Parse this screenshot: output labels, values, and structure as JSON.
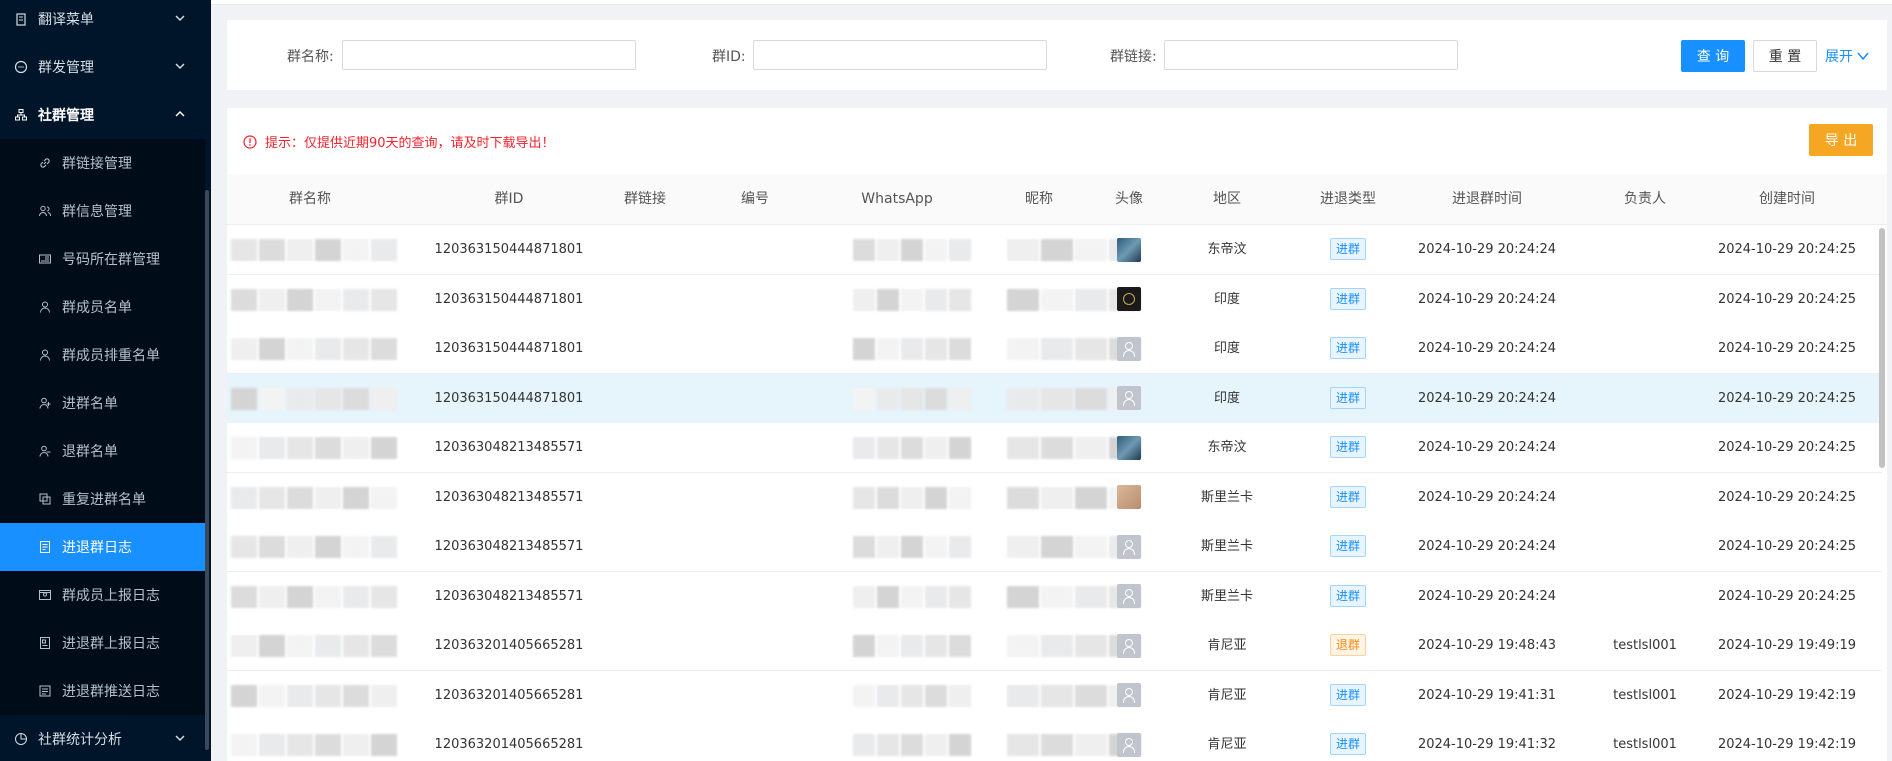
{
  "sidebar": {
    "items": [
      {
        "label": "翻译菜单",
        "icon": "clipboard-icon",
        "level": "top",
        "expanded": false
      },
      {
        "label": "群发管理",
        "icon": "chat-icon",
        "level": "top",
        "expanded": false
      },
      {
        "label": "社群管理",
        "icon": "org-icon",
        "level": "top",
        "expanded": true
      },
      {
        "label": "群链接管理",
        "icon": "link-icon",
        "level": "sub"
      },
      {
        "label": "群信息管理",
        "icon": "users-icon",
        "level": "sub"
      },
      {
        "label": "号码所在群管理",
        "icon": "card-icon",
        "level": "sub"
      },
      {
        "label": "群成员名单",
        "icon": "user-icon",
        "level": "sub"
      },
      {
        "label": "群成员排重名单",
        "icon": "user-icon",
        "level": "sub"
      },
      {
        "label": "进群名单",
        "icon": "user-add-icon",
        "level": "sub"
      },
      {
        "label": "退群名单",
        "icon": "user-remove-icon",
        "level": "sub"
      },
      {
        "label": "重复进群名单",
        "icon": "copy-icon",
        "level": "sub"
      },
      {
        "label": "进退群日志",
        "icon": "log-icon",
        "level": "sub",
        "active": true
      },
      {
        "label": "群成员上报日志",
        "icon": "report-icon",
        "level": "sub"
      },
      {
        "label": "进退群上报日志",
        "icon": "report-doc-icon",
        "level": "sub"
      },
      {
        "label": "进退群推送日志",
        "icon": "push-icon",
        "level": "sub"
      },
      {
        "label": "社群统计分析",
        "icon": "chart-icon",
        "level": "top",
        "expanded": false
      }
    ]
  },
  "search": {
    "group_name_label": "群名称:",
    "group_id_label": "群ID:",
    "group_link_label": "群链接:",
    "group_name_value": "",
    "group_id_value": "",
    "group_link_value": "",
    "query_label": "查 询",
    "reset_label": "重 置",
    "expand_label": "展开"
  },
  "toolbar": {
    "tip": "提示：仅提供近期90天的查询，请及时下载导出！",
    "export_label": "导 出"
  },
  "table": {
    "columns": [
      "群名称",
      "群ID",
      "群链接",
      "编号",
      "WhatsApp",
      "昵称",
      "头像",
      "地区",
      "进退类型",
      "进退群时间",
      "负责人",
      "创建时间"
    ],
    "rows": [
      {
        "group_id": "120363150444871801",
        "avatar": "photo",
        "region": "东帝汶",
        "type": "进群",
        "time": "2024-10-29 20:24:24",
        "owner": "",
        "created": "2024-10-29 20:24:25"
      },
      {
        "group_id": "120363150444871801",
        "avatar": "dark",
        "region": "印度",
        "type": "进群",
        "time": "2024-10-29 20:24:24",
        "owner": "",
        "created": "2024-10-29 20:24:25"
      },
      {
        "group_id": "120363150444871801",
        "avatar": "default",
        "region": "印度",
        "type": "进群",
        "time": "2024-10-29 20:24:24",
        "owner": "",
        "created": "2024-10-29 20:24:25"
      },
      {
        "group_id": "120363150444871801",
        "avatar": "default",
        "region": "印度",
        "type": "进群",
        "time": "2024-10-29 20:24:24",
        "owner": "",
        "created": "2024-10-29 20:24:25",
        "highlight": true
      },
      {
        "group_id": "120363048213485571",
        "avatar": "photo",
        "region": "东帝汶",
        "type": "进群",
        "time": "2024-10-29 20:24:24",
        "owner": "",
        "created": "2024-10-29 20:24:25"
      },
      {
        "group_id": "120363048213485571",
        "avatar": "pet",
        "region": "斯里兰卡",
        "type": "进群",
        "time": "2024-10-29 20:24:24",
        "owner": "",
        "created": "2024-10-29 20:24:25"
      },
      {
        "group_id": "120363048213485571",
        "avatar": "default",
        "region": "斯里兰卡",
        "type": "进群",
        "time": "2024-10-29 20:24:24",
        "owner": "",
        "created": "2024-10-29 20:24:25"
      },
      {
        "group_id": "120363048213485571",
        "avatar": "default",
        "region": "斯里兰卡",
        "type": "进群",
        "time": "2024-10-29 20:24:24",
        "owner": "",
        "created": "2024-10-29 20:24:25"
      },
      {
        "group_id": "120363201405665281",
        "avatar": "default",
        "region": "肯尼亚",
        "type": "退群",
        "time": "2024-10-29 19:48:43",
        "owner": "testlsl001",
        "created": "2024-10-29 19:49:19"
      },
      {
        "group_id": "120363201405665281",
        "avatar": "default",
        "region": "肯尼亚",
        "type": "进群",
        "time": "2024-10-29 19:41:31",
        "owner": "testlsl001",
        "created": "2024-10-29 19:42:19"
      },
      {
        "group_id": "120363201405665281",
        "avatar": "default",
        "region": "肯尼亚",
        "type": "进群",
        "time": "2024-10-29 19:41:32",
        "owner": "testlsl001",
        "created": "2024-10-29 19:42:19"
      }
    ]
  },
  "colors": {
    "sidebar_bg": "#001529",
    "accent": "#1890ff",
    "warn": "#f5a623",
    "tip_red": "#f5222d"
  }
}
